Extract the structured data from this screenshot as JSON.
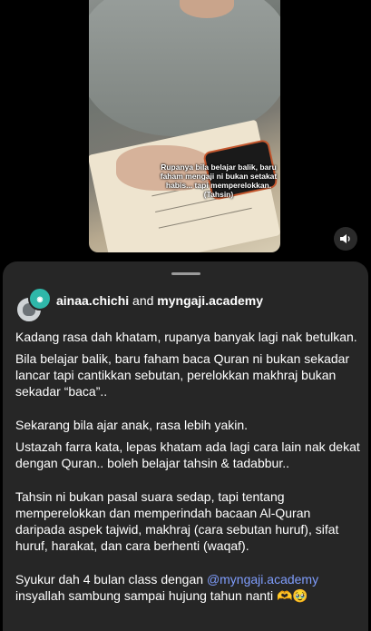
{
  "video": {
    "caption_overlay": "Rupanya bila belajar balik, baru faham mengaji ni bukan setakat habis... tapi memperelokkan. (Tahsin)"
  },
  "sound_icon": "speaker-icon",
  "post": {
    "author_1": "ainaa.chichi",
    "joiner": "and",
    "author_2": "myngaji.academy",
    "lines": {
      "p1": "Kadang rasa dah khatam, rupanya banyak lagi nak betulkan.",
      "p2": "Bila belajar balik, baru faham baca Quran ni bukan sekadar lancar tapi cantikkan sebutan, perelokkan makhraj bukan sekadar “baca”..",
      "p3": "Sekarang bila ajar anak, rasa lebih yakin.",
      "p4": "Ustazah farra kata, lepas khatam ada lagi cara lain nak dekat dengan Quran.. boleh belajar tahsin & tadabbur..",
      "p5": "Tahsin ni bukan pasal suara sedap, tapi tentang memperelokkan dan memperindah bacaan Al-Quran daripada aspek tajwid, makhraj (cara sebutan huruf), sifat huruf, harakat, dan cara berhenti (waqaf).",
      "p6_start": "Syukur dah 4 bulan class dengan",
      "p6_mention": "@myngaji.academy",
      "p6_end": "insyallah sambung sampai hujung tahun nanti 🫶🥹"
    }
  },
  "colors": {
    "mention": "#7f9dfc",
    "sheet": "#262626"
  }
}
